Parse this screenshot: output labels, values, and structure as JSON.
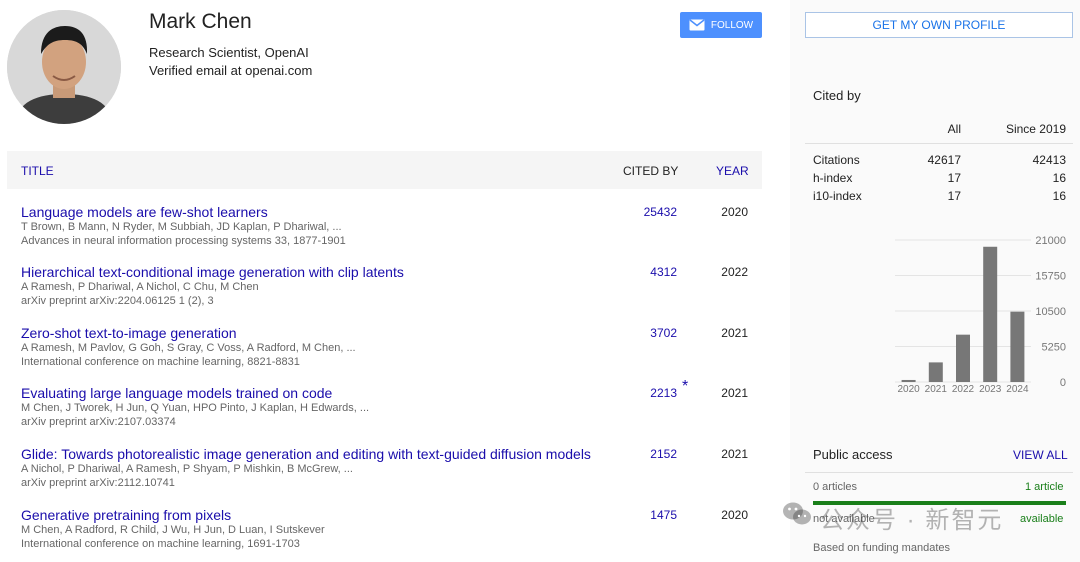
{
  "profile": {
    "name": "Mark Chen",
    "affiliation": "Research Scientist, OpenAI",
    "email": "Verified email at openai.com",
    "follow_label": "FOLLOW"
  },
  "table": {
    "headers": {
      "title": "TITLE",
      "cited_by": "CITED BY",
      "year": "YEAR"
    },
    "rows": [
      {
        "title": "Language models are few-shot learners",
        "authors": "T Brown, B Mann, N Ryder, M Subbiah, JD Kaplan, P Dhariwal, ...",
        "venue": "Advances in neural information processing systems 33, 1877-1901",
        "cited": "25432",
        "star": "",
        "year": "2020"
      },
      {
        "title": "Hierarchical text-conditional image generation with clip latents",
        "authors": "A Ramesh, P Dhariwal, A Nichol, C Chu, M Chen",
        "venue": "arXiv preprint arXiv:2204.06125 1 (2), 3",
        "cited": "4312",
        "star": "",
        "year": "2022"
      },
      {
        "title": "Zero-shot text-to-image generation",
        "authors": "A Ramesh, M Pavlov, G Goh, S Gray, C Voss, A Radford, M Chen, ...",
        "venue": "International conference on machine learning, 8821-8831",
        "cited": "3702",
        "star": "",
        "year": "2021"
      },
      {
        "title": "Evaluating large language models trained on code",
        "authors": "M Chen, J Tworek, H Jun, Q Yuan, HPO Pinto, J Kaplan, H Edwards, ...",
        "venue": "arXiv preprint arXiv:2107.03374",
        "cited": "2213",
        "star": "*",
        "year": "2021"
      },
      {
        "title": "Glide: Towards photorealistic image generation and editing with text-guided diffusion models",
        "authors": "A Nichol, P Dhariwal, A Ramesh, P Shyam, P Mishkin, B McGrew, ...",
        "venue": "arXiv preprint arXiv:2112.10741",
        "cited": "2152",
        "star": "",
        "year": "2021"
      },
      {
        "title": "Generative pretraining from pixels",
        "authors": "M Chen, A Radford, R Child, J Wu, H Jun, D Luan, I Sutskever",
        "venue": "International conference on machine learning, 1691-1703",
        "cited": "1475",
        "star": "",
        "year": "2020"
      }
    ]
  },
  "sidebar": {
    "own_profile_label": "GET MY OWN PROFILE",
    "cited_by_title": "Cited by",
    "stats_headers": {
      "all": "All",
      "since": "Since 2019"
    },
    "stats": [
      {
        "label": "Citations",
        "all": "42617",
        "since": "42413"
      },
      {
        "label": "h-index",
        "all": "17",
        "since": "16"
      },
      {
        "label": "i10-index",
        "all": "17",
        "since": "16"
      }
    ],
    "public_access": {
      "title": "Public access",
      "view_all": "VIEW ALL",
      "not_available": "0 articles",
      "available": "1 article",
      "not_available_label": "not available",
      "available_label": "available",
      "available_fraction": 1.0,
      "mandates": "Based on funding mandates"
    }
  },
  "chart_data": {
    "type": "bar",
    "categories": [
      "2020",
      "2021",
      "2022",
      "2023",
      "2024"
    ],
    "values": [
      300,
      2900,
      7000,
      20000,
      10400
    ],
    "ylim": [
      0,
      21000
    ],
    "yticks": [
      "0",
      "5250",
      "10500",
      "15750",
      "21000"
    ],
    "bar_color": "#777777",
    "grid": true
  },
  "watermark": {
    "text": "公众号 · 新智元"
  },
  "colors": {
    "link": "#1a0dab",
    "follow": "#4d90fe",
    "green": "#1a7f1a"
  },
  "icons": {
    "follow": "mail-icon",
    "watermark": "wechat-icon"
  }
}
